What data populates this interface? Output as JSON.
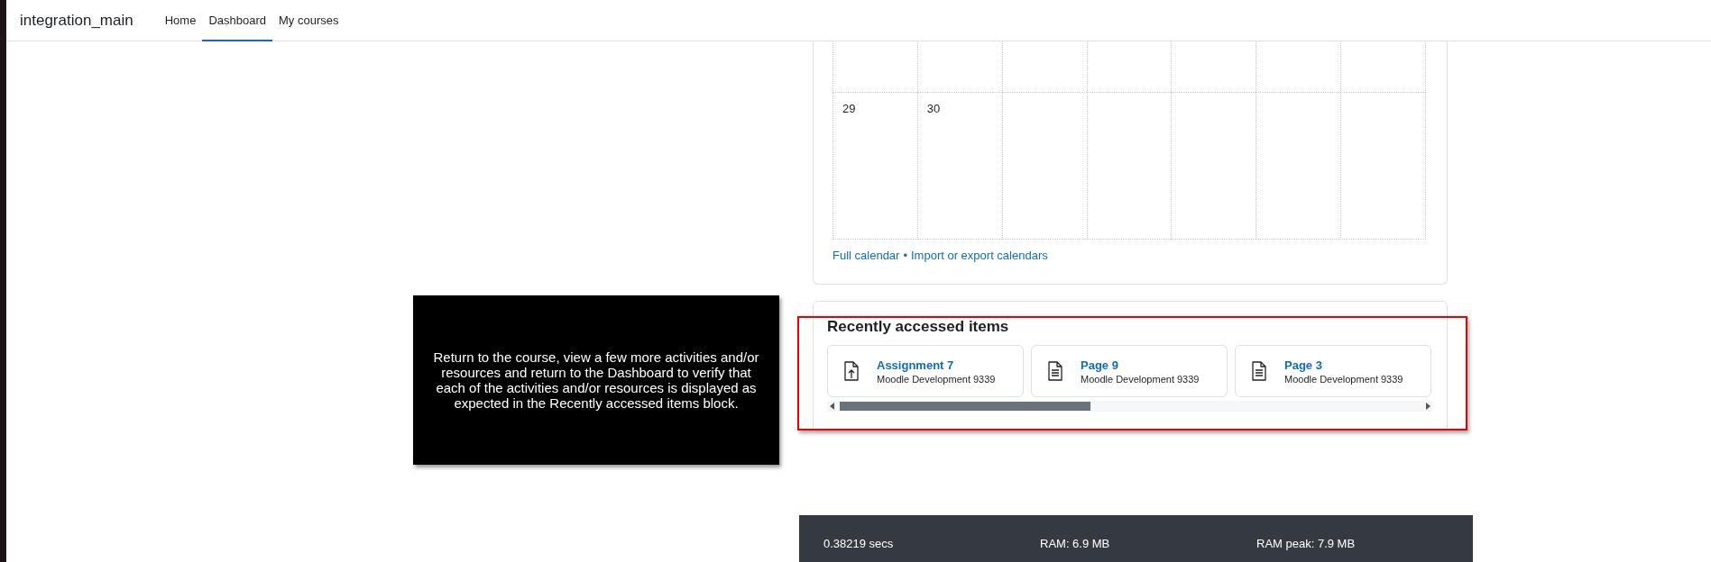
{
  "navbar": {
    "brand": "integration_main",
    "items": [
      {
        "label": "Home",
        "selected": false
      },
      {
        "label": "Dashboard",
        "selected": true
      },
      {
        "label": "My courses",
        "selected": false
      }
    ]
  },
  "calendar": {
    "weeks": [
      {
        "days": [
          "29",
          "30"
        ]
      }
    ],
    "links": [
      {
        "label": "Full calendar"
      },
      {
        "label": "Import or export calendars"
      }
    ],
    "separator": "•"
  },
  "recent": {
    "title": "Recently accessed items",
    "items": [
      {
        "kind": "assignment",
        "name": "Assignment 7",
        "course": "Moodle Development 9339"
      },
      {
        "kind": "page",
        "name": "Page 9",
        "course": "Moodle Development 9339"
      },
      {
        "kind": "page",
        "name": "Page 3",
        "course": "Moodle Development 9339"
      }
    ]
  },
  "instruction": {
    "text": "Return to the course, view a few more activities and/or resources and return to the Dashboard to verify that each of the activities and/or resources is displayed as expected in the Recently accessed items block."
  },
  "footer": {
    "items": [
      "0.38219 secs",
      "RAM: 6.9 MB",
      "RAM peak: 7.9 MB"
    ]
  }
}
